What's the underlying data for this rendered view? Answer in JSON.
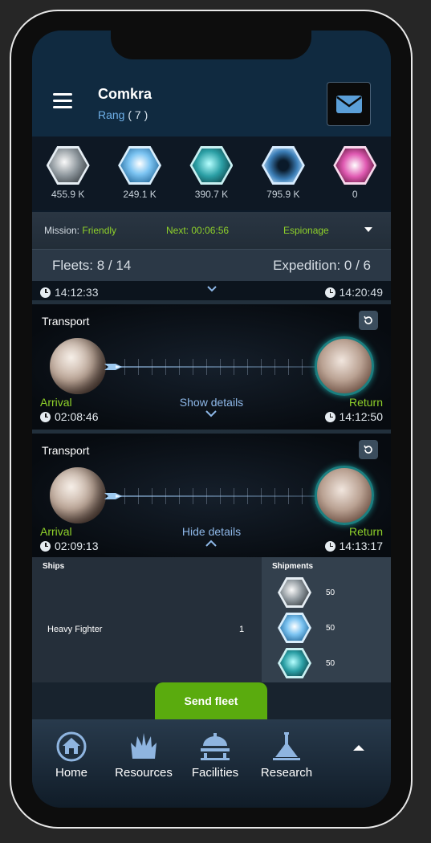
{
  "header": {
    "player_name": "Comkra",
    "rank_label": "Rang",
    "rank_value": "( 7 )"
  },
  "resources": [
    {
      "name": "metal",
      "icon": "metal-icon",
      "value": "455.9 K"
    },
    {
      "name": "crystal",
      "icon": "crystal-icon",
      "value": "249.1 K"
    },
    {
      "name": "deuterium",
      "icon": "deuterium-icon",
      "value": "390.7 K"
    },
    {
      "name": "energy",
      "icon": "energy-icon",
      "value": "795.9 K"
    },
    {
      "name": "dark-matter",
      "icon": "dark-matter-icon",
      "value": "0"
    }
  ],
  "mission_bar": {
    "mission_label": "Mission:",
    "mission_value": "Friendly",
    "next_label": "Next: 00:06:56",
    "espionage_label": "Espionage"
  },
  "fleets_bar": {
    "fleets": "Fleets: 8 / 14",
    "expedition": "Expedition: 0 / 6"
  },
  "partial_card": {
    "left_time": "14:12:33",
    "right_time": "14:20:49"
  },
  "missions": [
    {
      "title": "Transport",
      "arrival_label": "Arrival",
      "arrival_time": "02:08:46",
      "details_label": "Show details",
      "return_label": "Return",
      "return_time": "14:12:50"
    },
    {
      "title": "Transport",
      "arrival_label": "Arrival",
      "arrival_time": "02:09:13",
      "details_label": "Hide details",
      "return_label": "Return",
      "return_time": "14:13:17"
    }
  ],
  "details": {
    "ships_title": "Ships",
    "ship_name": "Heavy Fighter",
    "ship_count": "1",
    "shipments_title": "Shipments",
    "shipments": [
      {
        "icon": "metal-icon",
        "value": "50"
      },
      {
        "icon": "crystal-icon",
        "value": "50"
      },
      {
        "icon": "deuterium-icon",
        "value": "50"
      }
    ]
  },
  "send_fleet_label": "Send fleet",
  "nav": [
    {
      "label": "Home",
      "icon": "home-icon"
    },
    {
      "label": "Resources",
      "icon": "resources-icon"
    },
    {
      "label": "Facilities",
      "icon": "facilities-icon"
    },
    {
      "label": "Research",
      "icon": "research-icon"
    }
  ],
  "colors": {
    "accent_green": "#8fd12a",
    "button_green": "#5aab0e",
    "link_blue": "#8eb8e8"
  }
}
